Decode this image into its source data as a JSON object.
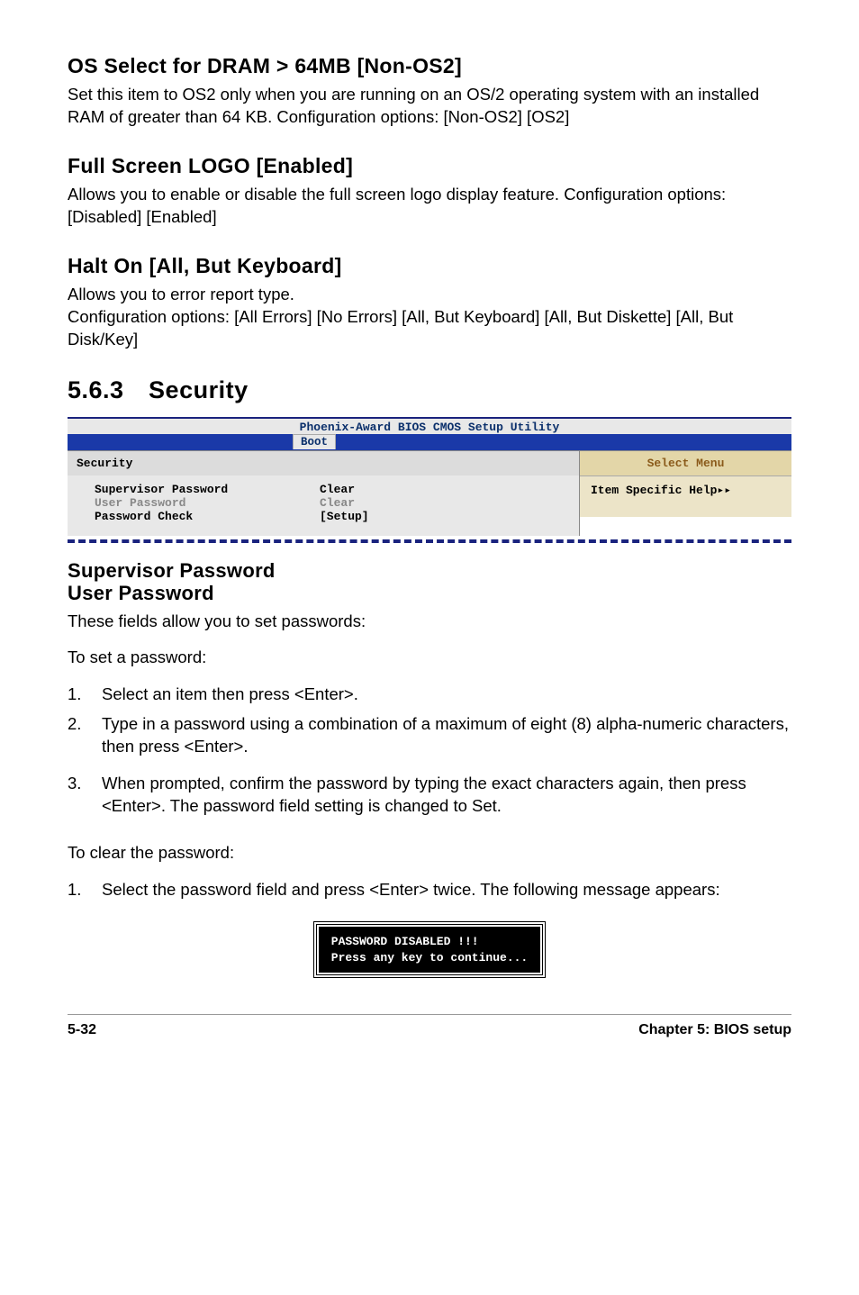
{
  "sections": {
    "os_select": {
      "heading": "OS Select for DRAM > 64MB [Non-OS2]",
      "body": "Set this item to OS2 only when you are running on an OS/2 operating system with an installed RAM of greater than 64 KB. Configuration options: [Non-OS2] [OS2]"
    },
    "full_screen": {
      "heading": "Full Screen LOGO [Enabled]",
      "body": "Allows you to enable or disable the full screen logo display feature. Configuration options: [Disabled] [Enabled]"
    },
    "halt_on": {
      "heading": "Halt On [All, But Keyboard]",
      "body": "Allows you to error report type.\nConfiguration options: [All Errors] [No Errors] [All, But Keyboard] [All, But Diskette] [All, But Disk/Key]"
    }
  },
  "security_header": "5.6.3 Security",
  "bios": {
    "title": "Phoenix-Award BIOS CMOS Setup Utility",
    "tab": "Boot",
    "left_header": "Security",
    "rows": [
      {
        "label": "Supervisor Password",
        "value": "Clear",
        "cls": "row-norm"
      },
      {
        "label": "User Password",
        "value": "Clear",
        "cls": "row-grey"
      },
      {
        "label": "Password Check",
        "value": "[Setup]",
        "cls": "row-norm"
      }
    ],
    "right_header": "Select Menu",
    "right_body": "Item Specific Help▸▸"
  },
  "supervisor": {
    "heading1": "Supervisor Password",
    "heading2": "User Password",
    "intro": "These fields allow you to set passwords:",
    "set_label": "To set a password:",
    "set_steps": [
      "Select an item then press <Enter>.",
      "Type in a password using a combination of a maximum of eight (8) alpha-numeric characters, then press <Enter>.",
      "When prompted, confirm the password by typing the exact characters again, then press <Enter>. The password field setting is changed to Set."
    ],
    "clear_label": "To clear the password:",
    "clear_steps": [
      "Select the password field and press <Enter> twice. The following message appears:"
    ]
  },
  "msgbox": "PASSWORD DISABLED !!!\nPress any key to continue...",
  "footer": {
    "left": "5-32",
    "right": "Chapter 5: BIOS setup"
  }
}
